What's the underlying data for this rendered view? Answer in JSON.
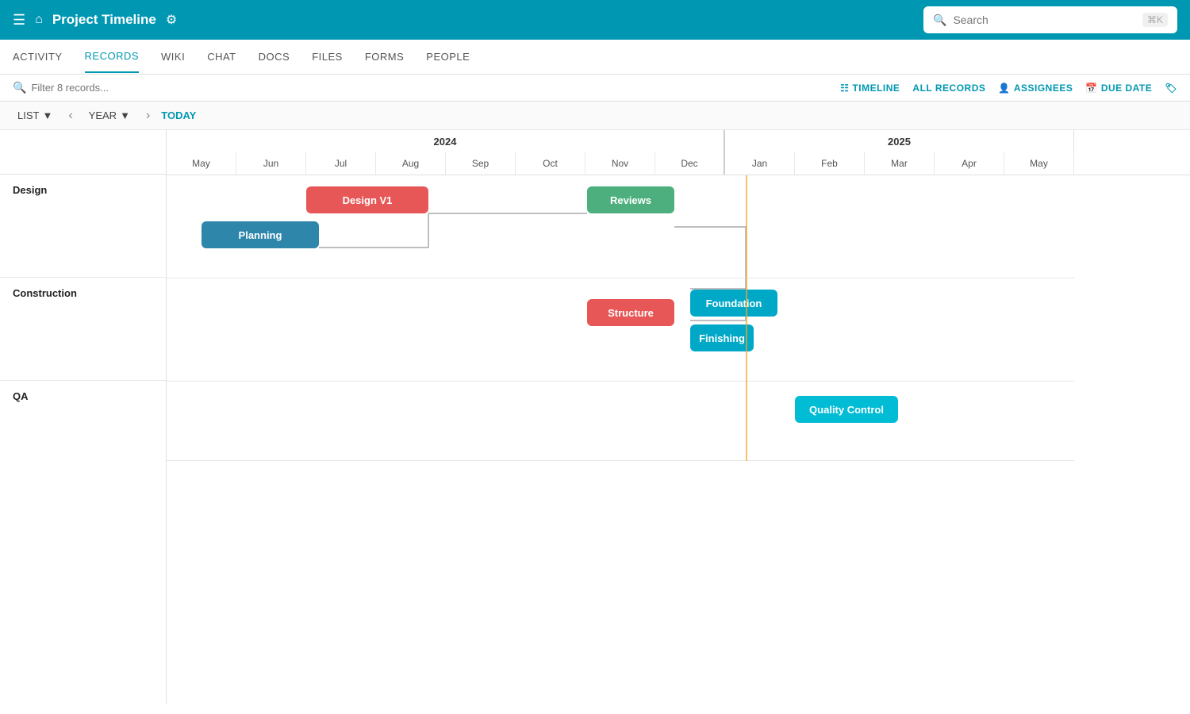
{
  "header": {
    "title": "Project Timeline",
    "search_placeholder": "Search",
    "shortcut": "⌘K"
  },
  "nav": {
    "tabs": [
      {
        "label": "ACTIVITY",
        "active": false
      },
      {
        "label": "RECORDS",
        "active": true
      },
      {
        "label": "WIKI",
        "active": false
      },
      {
        "label": "CHAT",
        "active": false
      },
      {
        "label": "DOCS",
        "active": false
      },
      {
        "label": "FILES",
        "active": false
      },
      {
        "label": "FORMS",
        "active": false
      },
      {
        "label": "PEOPLE",
        "active": false
      }
    ]
  },
  "toolbar": {
    "filter_placeholder": "Filter 8 records...",
    "timeline_label": "TIMELINE",
    "all_records_label": "ALL RECORDS",
    "assignees_label": "ASSIGNEES",
    "due_date_label": "DUE DATE"
  },
  "view_controls": {
    "list_label": "LIST",
    "year_label": "YEAR",
    "today_label": "TODAY"
  },
  "timeline": {
    "years": [
      {
        "label": "2024",
        "months": [
          "May",
          "Jun",
          "Jul",
          "Aug",
          "Sep",
          "Oct",
          "Nov",
          "Dec"
        ]
      },
      {
        "label": "2025",
        "months": [
          "Jan",
          "Feb",
          "Mar",
          "Apr",
          "May"
        ]
      }
    ],
    "groups": [
      {
        "label": "Design"
      },
      {
        "label": "Construction"
      },
      {
        "label": "QA"
      }
    ],
    "tasks": [
      {
        "label": "Design V1",
        "group": "Design",
        "color": "red"
      },
      {
        "label": "Planning",
        "group": "Design",
        "color": "teal-dark"
      },
      {
        "label": "Reviews",
        "group": "Design",
        "color": "green"
      },
      {
        "label": "Structure",
        "group": "Construction",
        "color": "red"
      },
      {
        "label": "Foundation",
        "group": "Construction",
        "color": "teal"
      },
      {
        "label": "Finishing",
        "group": "Construction",
        "color": "teal"
      },
      {
        "label": "Quality Control",
        "group": "QA",
        "color": "teal-light"
      }
    ]
  }
}
